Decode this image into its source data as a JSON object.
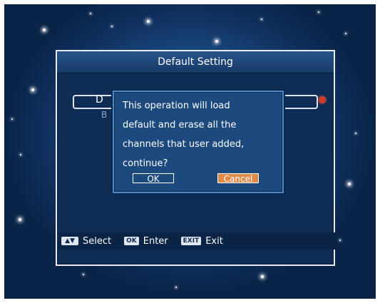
{
  "menu": {
    "title": "Default Setting",
    "field_text": "D",
    "field_sub": "B"
  },
  "dialog": {
    "message": "This operation will load\ndefault and erase all the\nchannels that user added,\ncontinue?",
    "ok_label": "OK",
    "cancel_label": "Cancel",
    "selected_button": "Cancel"
  },
  "help_bar": {
    "items": [
      {
        "key": "▲▼",
        "icon": "up-down-arrows-icon",
        "label": "Select"
      },
      {
        "key": "OK",
        "icon": "ok-key-icon",
        "label": "Enter"
      },
      {
        "key": "EXIT",
        "icon": "exit-key-icon",
        "label": "Exit"
      }
    ]
  },
  "colors": {
    "background": "#1d4f88",
    "window": "#0e2c54",
    "dialog": "#1c4a7e",
    "dialog_border": "#4c88c8",
    "highlight_button": "#e08a4a",
    "knob": "#d23a2a"
  }
}
